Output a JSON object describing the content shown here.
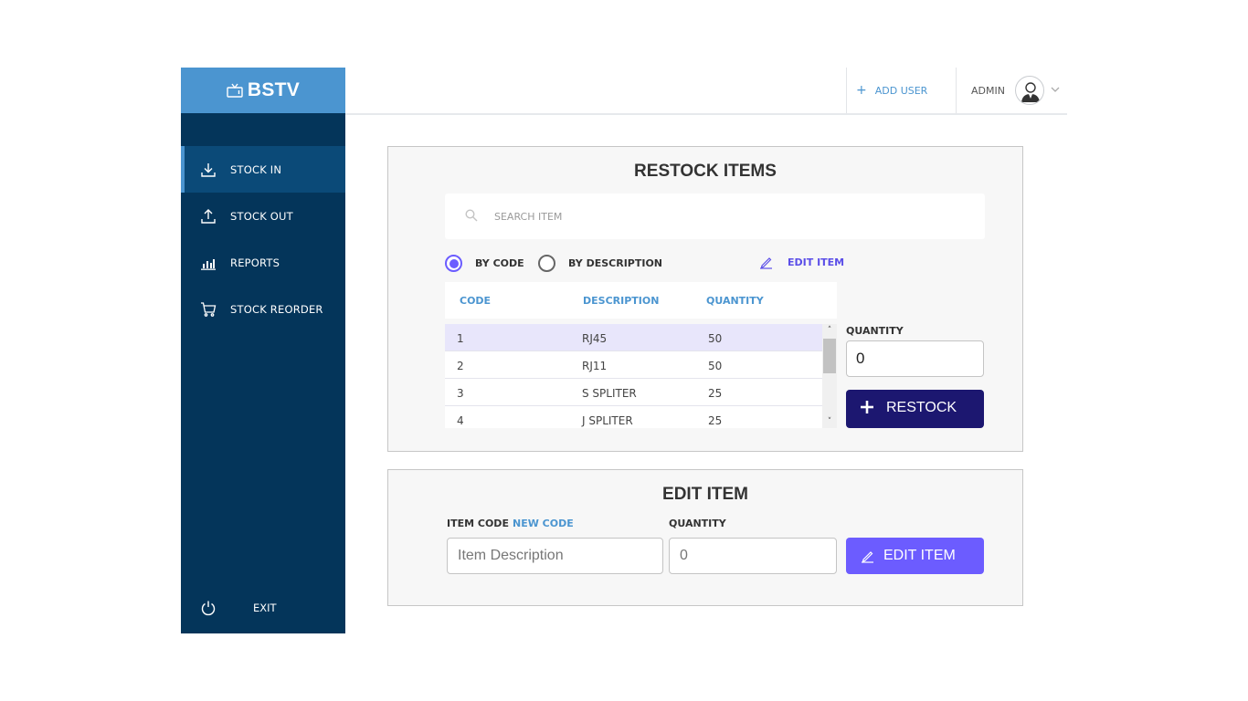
{
  "brand": {
    "name": "BSTV"
  },
  "sidebar": {
    "items": [
      {
        "label": "STOCK IN",
        "icon": "download-icon",
        "active": true
      },
      {
        "label": "STOCK OUT",
        "icon": "upload-icon",
        "active": false
      },
      {
        "label": "REPORTS",
        "icon": "bar-chart-icon",
        "active": false
      },
      {
        "label": "STOCK REORDER",
        "icon": "cart-icon",
        "active": false
      }
    ],
    "exit_label": "EXIT"
  },
  "topbar": {
    "add_user_label": "ADD USER",
    "user_name": "ADMIN"
  },
  "restock": {
    "title": "RESTOCK ITEMS",
    "search_placeholder": "SEARCH ITEM",
    "radio_by_code": "BY CODE",
    "radio_by_description": "BY DESCRIPTION",
    "selected_filter": "BY CODE",
    "edit_link": "EDIT ITEM",
    "columns": [
      "CODE",
      "DESCRIPTION",
      "QUANTITY"
    ],
    "rows": [
      {
        "code": "1",
        "description": "RJ45",
        "quantity": "50"
      },
      {
        "code": "2",
        "description": "RJ11",
        "quantity": "50"
      },
      {
        "code": "3",
        "description": "S SPLITER",
        "quantity": "25"
      },
      {
        "code": "4",
        "description": "J SPLITER",
        "quantity": "25"
      }
    ],
    "selected_row": 0,
    "quantity_label": "QUANTITY",
    "quantity_value": "0",
    "restock_button": "RESTOCK"
  },
  "edit": {
    "title": "EDIT ITEM",
    "item_code_label": "ITEM CODE :",
    "item_code_value": "NEW CODE",
    "quantity_label": "QUANTITY",
    "description_placeholder": "Item Description",
    "quantity_value": "0",
    "edit_button": "EDIT ITEM"
  },
  "colors": {
    "sidebar_bg": "#04355a",
    "sidebar_active": "#0b4a78",
    "brand_blue": "#4b95d0",
    "accent_purple": "#6c5cff",
    "restock_navy": "#1c1770"
  }
}
